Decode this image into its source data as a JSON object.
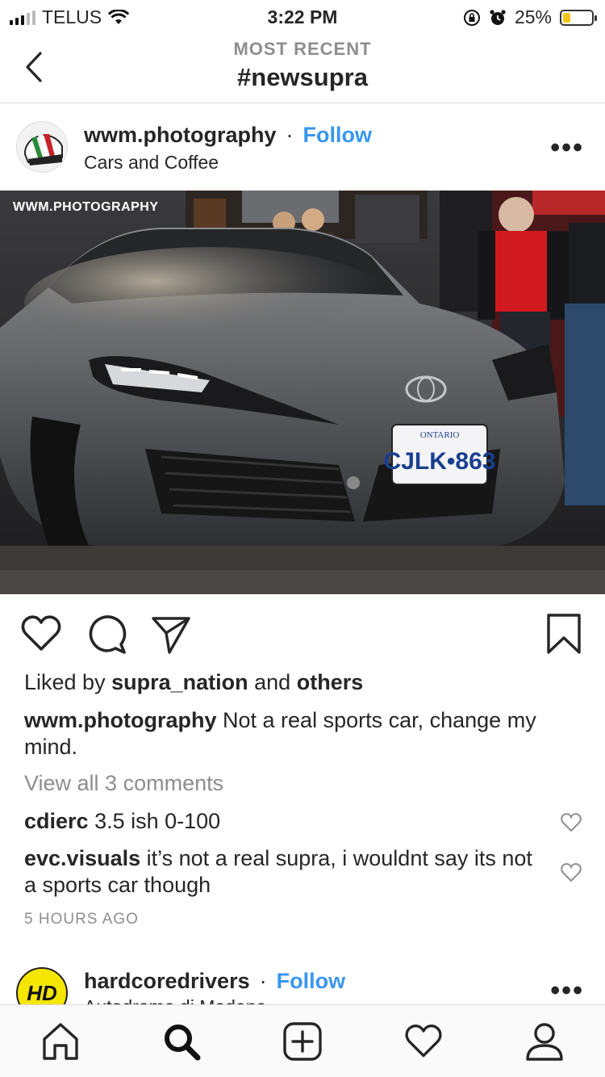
{
  "status_bar": {
    "carrier": "TELUS",
    "time": "3:22 PM",
    "battery_percent": "25%",
    "battery_level": 0.25
  },
  "nav": {
    "subtitle": "MOST RECENT",
    "title": "#newsupra"
  },
  "post": {
    "username": "wwm.photography",
    "separator": "·",
    "follow_label": "Follow",
    "location": "Cars and Coffee",
    "more_label": "•••",
    "photo_watermark": "WWM.PHOTOGRAPHY",
    "plate_province": "ONTARIO",
    "plate_number": "CJLK•863",
    "likes_prefix": "Liked by",
    "likes_user": "supra_nation",
    "likes_and": "and",
    "likes_others": "others",
    "caption_user": "wwm.photography",
    "caption_text": "Not a real sports car, change my mind.",
    "view_all_comments": "View all 3 comments",
    "comments": [
      {
        "user": "cdierc",
        "text": "3.5 ish 0-100"
      },
      {
        "user": "evc.visuals",
        "text": "it’s not a real supra, i wouldnt say its not a sports car though"
      }
    ],
    "timestamp": "5 HOURS AGO"
  },
  "next_post": {
    "username": "hardcoredrivers",
    "separator": "·",
    "follow_label": "Follow",
    "location": "Autodromo di Modena",
    "avatar_text": "HD",
    "more_label": "•••"
  },
  "icons": {
    "back": "chevron-left-icon",
    "like": "heart-icon",
    "comment": "comment-icon",
    "share": "send-icon",
    "save": "bookmark-icon",
    "home": "home-icon",
    "search": "search-icon",
    "add": "add-post-icon",
    "activity": "heart-icon",
    "profile": "profile-icon"
  },
  "colors": {
    "link_blue": "#3897f0",
    "muted_gray": "#8e8e8e",
    "text": "#262626",
    "battery_yellow": "#f5c518"
  }
}
